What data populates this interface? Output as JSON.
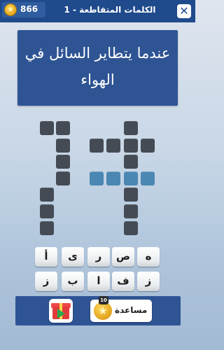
{
  "header": {
    "coins": "866",
    "coin_icon": "star-coin-icon",
    "level_title": "1 - الكلمات المتقاطعة",
    "close_icon": "close-x-icon",
    "close_glyph": "✕"
  },
  "clue": {
    "text": "عندما يتطاير السائل في الهواء"
  },
  "keyboard": {
    "row1": [
      "أ",
      "ى",
      "ر",
      "ص",
      "ه"
    ],
    "row2": [
      "ز",
      "ب",
      "ا",
      "ف",
      "ز"
    ]
  },
  "bottom": {
    "gift_icon": "gift-video-icon",
    "help_label": "مساعدة",
    "help_badge": "10",
    "help_icon": "star-coin-icon"
  },
  "colors": {
    "header": "#1f4a8c",
    "panel": "#2e5494",
    "cell": "#454b55",
    "highlight": "#4b87b3"
  }
}
